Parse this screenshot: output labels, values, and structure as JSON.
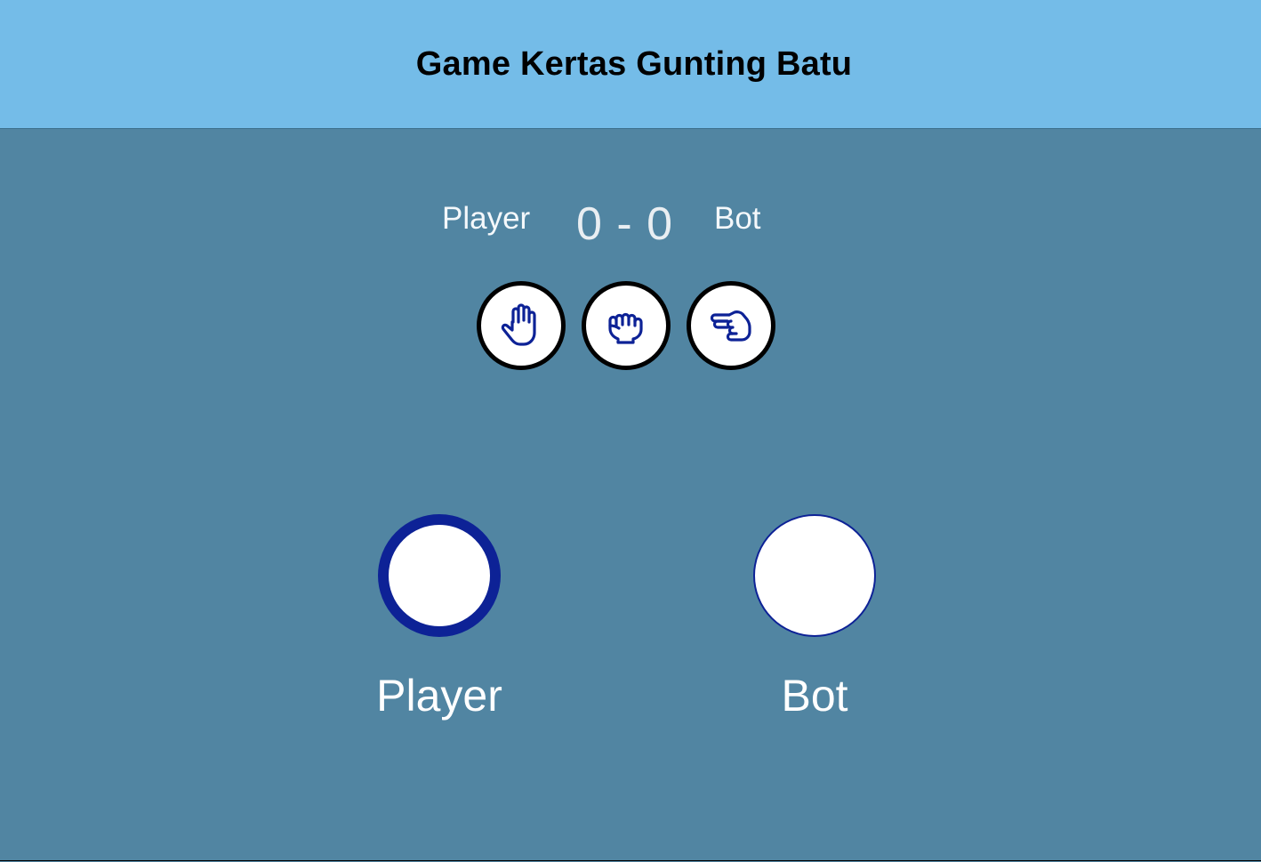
{
  "header": {
    "title": "Game Kertas Gunting Batu"
  },
  "scoreboard": {
    "player_label": "Player",
    "score": "0 - 0",
    "bot_label": "Bot"
  },
  "choices": [
    {
      "name": "paper",
      "icon": "hand-paper-icon"
    },
    {
      "name": "rock",
      "icon": "hand-rock-icon"
    },
    {
      "name": "scissors",
      "icon": "hand-scissors-icon"
    }
  ],
  "arena": {
    "player_label": "Player",
    "bot_label": "Bot"
  },
  "colors": {
    "header_bg": "#74bce8",
    "main_bg": "#5185a2",
    "icon_blue": "#0d2296",
    "button_border": "#000000"
  }
}
